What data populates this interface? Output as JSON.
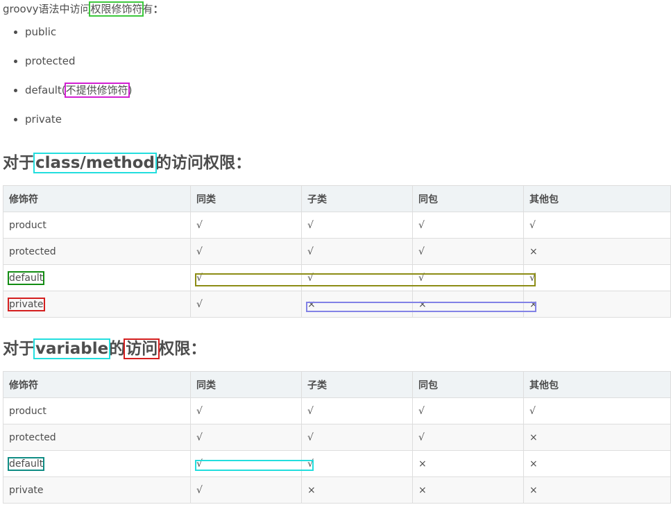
{
  "intro": {
    "prefix": "groovy语法中访问",
    "highlight": "权限修饰符",
    "suffix": "有",
    "colon": "："
  },
  "modifiers_list": [
    {
      "text": "public"
    },
    {
      "text": "protected"
    },
    {
      "text": "default(",
      "note": "不提供修饰符",
      "close": ")"
    },
    {
      "text": "private"
    }
  ],
  "section1": {
    "prefix": "对于",
    "highlight": "class/method",
    "suffix": "的访问权限："
  },
  "section2": {
    "prefix": "对于",
    "highlight": "variable",
    "middle": "的",
    "highlight2": "访问",
    "suffix": "权限："
  },
  "table_headers": [
    "修饰符",
    "同类",
    "子类",
    "同包",
    "其他包"
  ],
  "table1_rows": [
    [
      "product",
      "√",
      "√",
      "√",
      "√"
    ],
    [
      "protected",
      "√",
      "√",
      "√",
      "×"
    ],
    [
      "default",
      "√",
      "√",
      "√",
      "√"
    ],
    [
      "private",
      "√",
      "×",
      "×",
      "×"
    ]
  ],
  "table2_rows": [
    [
      "product",
      "√",
      "√",
      "√",
      "√"
    ],
    [
      "protected",
      "√",
      "√",
      "√",
      "×"
    ],
    [
      "default",
      "√",
      "√",
      "×",
      "×"
    ],
    [
      "private",
      "√",
      "×",
      "×",
      "×"
    ]
  ],
  "colors": {
    "text": "#4d4d4d",
    "header_bg": "#eff3f5",
    "highlight_green": "#3cc83c",
    "highlight_magenta": "#d21ed2",
    "highlight_cyan": "#22dede",
    "highlight_red": "#d41e1e",
    "box_olive": "#8c8c14",
    "box_purple": "#8282e6"
  }
}
